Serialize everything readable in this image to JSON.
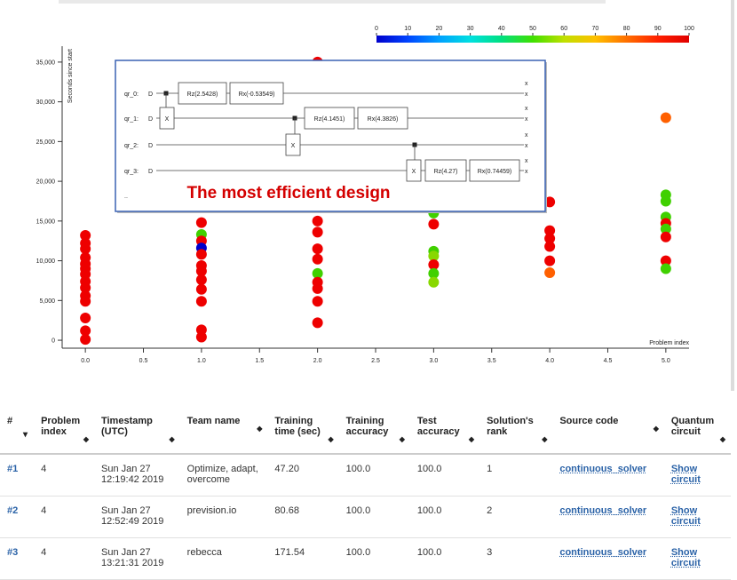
{
  "colorbar": {
    "ticks": [
      "0",
      "10",
      "20",
      "30",
      "40",
      "50",
      "60",
      "70",
      "80",
      "90",
      "100"
    ],
    "colors": [
      "#0000cc",
      "#0044ff",
      "#00a0ff",
      "#00e0e0",
      "#00e080",
      "#40e000",
      "#c0e000",
      "#ffc000",
      "#ff7000",
      "#ff2000",
      "#e00000"
    ]
  },
  "chart_data": {
    "type": "scatter",
    "ylabel": "Seconds since start",
    "xlabel": "Problem index",
    "xlim": [
      -0.2,
      5.2
    ],
    "ylim": [
      -1000,
      37000
    ],
    "xticks": [
      "0.0",
      "0.5",
      "1.0",
      "1.5",
      "2.0",
      "2.5",
      "3.0",
      "3.5",
      "4.0",
      "4.5",
      "5.0"
    ],
    "yticks": [
      "0",
      "5,000",
      "10,000",
      "15,000",
      "20,000",
      "25,000",
      "30,000",
      "35,000"
    ],
    "points": [
      {
        "x": 0,
        "y": 13200,
        "c": "#ee0000"
      },
      {
        "x": 0,
        "y": 12200,
        "c": "#ee0000"
      },
      {
        "x": 0,
        "y": 11500,
        "c": "#ee0000"
      },
      {
        "x": 0,
        "y": 10400,
        "c": "#ee0000"
      },
      {
        "x": 0,
        "y": 9600,
        "c": "#ee0000"
      },
      {
        "x": 0,
        "y": 9000,
        "c": "#ee0000"
      },
      {
        "x": 0,
        "y": 8300,
        "c": "#ee0000"
      },
      {
        "x": 0,
        "y": 7400,
        "c": "#ee0000"
      },
      {
        "x": 0,
        "y": 6600,
        "c": "#ee0000"
      },
      {
        "x": 0,
        "y": 5600,
        "c": "#ee0000"
      },
      {
        "x": 0,
        "y": 4900,
        "c": "#ee0000"
      },
      {
        "x": 0,
        "y": 2800,
        "c": "#ee0000"
      },
      {
        "x": 0,
        "y": 1200,
        "c": "#ee0000"
      },
      {
        "x": 0,
        "y": 100,
        "c": "#ee0000"
      },
      {
        "x": 1,
        "y": 14800,
        "c": "#ee0000"
      },
      {
        "x": 1,
        "y": 13300,
        "c": "#40d000"
      },
      {
        "x": 1,
        "y": 12500,
        "c": "#ee0000"
      },
      {
        "x": 1,
        "y": 11600,
        "c": "#0000cc"
      },
      {
        "x": 1,
        "y": 10800,
        "c": "#ee0000"
      },
      {
        "x": 1,
        "y": 9400,
        "c": "#ee0000"
      },
      {
        "x": 1,
        "y": 8700,
        "c": "#ee0000"
      },
      {
        "x": 1,
        "y": 7600,
        "c": "#ee0000"
      },
      {
        "x": 1,
        "y": 6400,
        "c": "#ee0000"
      },
      {
        "x": 1,
        "y": 4900,
        "c": "#ee0000"
      },
      {
        "x": 1,
        "y": 1300,
        "c": "#ee0000"
      },
      {
        "x": 1,
        "y": 400,
        "c": "#ee0000"
      },
      {
        "x": 2,
        "y": 35000,
        "c": "#ee0000"
      },
      {
        "x": 2,
        "y": 15000,
        "c": "#ee0000"
      },
      {
        "x": 2,
        "y": 13600,
        "c": "#ee0000"
      },
      {
        "x": 2,
        "y": 11500,
        "c": "#ee0000"
      },
      {
        "x": 2,
        "y": 10200,
        "c": "#ee0000"
      },
      {
        "x": 2,
        "y": 8400,
        "c": "#40d000"
      },
      {
        "x": 2,
        "y": 7300,
        "c": "#ee0000"
      },
      {
        "x": 2,
        "y": 6500,
        "c": "#ee0000"
      },
      {
        "x": 2,
        "y": 4900,
        "c": "#ee0000"
      },
      {
        "x": 2,
        "y": 2200,
        "c": "#ee0000"
      },
      {
        "x": 3,
        "y": 16000,
        "c": "#40d000"
      },
      {
        "x": 3,
        "y": 14600,
        "c": "#ee0000"
      },
      {
        "x": 3,
        "y": 11200,
        "c": "#40d000"
      },
      {
        "x": 3,
        "y": 10600,
        "c": "#88d800"
      },
      {
        "x": 3,
        "y": 9500,
        "c": "#ee0000"
      },
      {
        "x": 3,
        "y": 8400,
        "c": "#40d000"
      },
      {
        "x": 3,
        "y": 7300,
        "c": "#88d800"
      },
      {
        "x": 4,
        "y": 17400,
        "c": "#ee0000"
      },
      {
        "x": 4,
        "y": 13800,
        "c": "#ee0000"
      },
      {
        "x": 4,
        "y": 12800,
        "c": "#ee0000"
      },
      {
        "x": 4,
        "y": 11800,
        "c": "#ee0000"
      },
      {
        "x": 4,
        "y": 10000,
        "c": "#ee0000"
      },
      {
        "x": 4,
        "y": 8500,
        "c": "#ff6000"
      },
      {
        "x": 5,
        "y": 28000,
        "c": "#ff6000"
      },
      {
        "x": 5,
        "y": 18300,
        "c": "#40d000"
      },
      {
        "x": 5,
        "y": 17500,
        "c": "#40d000"
      },
      {
        "x": 5,
        "y": 15500,
        "c": "#40d000"
      },
      {
        "x": 5,
        "y": 14700,
        "c": "#ee0000"
      },
      {
        "x": 5,
        "y": 14000,
        "c": "#40d000"
      },
      {
        "x": 5,
        "y": 13000,
        "c": "#ee0000"
      },
      {
        "x": 5,
        "y": 10000,
        "c": "#ee0000"
      },
      {
        "x": 5,
        "y": 9000,
        "c": "#40d000"
      }
    ]
  },
  "circuit": {
    "qubits": [
      {
        "label": "qr_0:",
        "gates": [
          "Rz(2.5428)",
          "Rx(-0.53549)"
        ]
      },
      {
        "label": "qr_1:",
        "gates": [
          "X",
          "Rz(4.1451)",
          "Rx(4.3826)"
        ]
      },
      {
        "label": "qr_2:",
        "gates": [
          "X"
        ]
      },
      {
        "label": "qr_3:",
        "gates": [
          "X",
          "Rz(4.27)",
          "Rx(0.74459)"
        ]
      }
    ],
    "measure_mark": "x",
    "caption": "The most efficient design"
  },
  "table": {
    "headers": [
      "#",
      "Problem index",
      "Timestamp (UTC)",
      "Team name",
      "Training time (sec)",
      "Training accuracy",
      "Test accuracy",
      "Solution's rank",
      "Source code",
      "Quantum circuit"
    ],
    "rows": [
      {
        "id": "#1",
        "problem": "4",
        "timestamp": "Sun Jan 27 12:19:42 2019",
        "team": "Optimize, adapt, overcome",
        "time": "47.20",
        "train_acc": "100.0",
        "test_acc": "100.0",
        "rank": "1",
        "source": "continuous_solver",
        "circuit": "Show circuit"
      },
      {
        "id": "#2",
        "problem": "4",
        "timestamp": "Sun Jan 27 12:52:49 2019",
        "team": "prevision.io",
        "time": "80.68",
        "train_acc": "100.0",
        "test_acc": "100.0",
        "rank": "2",
        "source": "continuous_solver",
        "circuit": "Show circuit"
      },
      {
        "id": "#3",
        "problem": "4",
        "timestamp": "Sun Jan 27 13:21:31 2019",
        "team": "rebecca",
        "time": "171.54",
        "train_acc": "100.0",
        "test_acc": "100.0",
        "rank": "3",
        "source": "continuous_solver",
        "circuit": "Show circuit"
      }
    ]
  }
}
